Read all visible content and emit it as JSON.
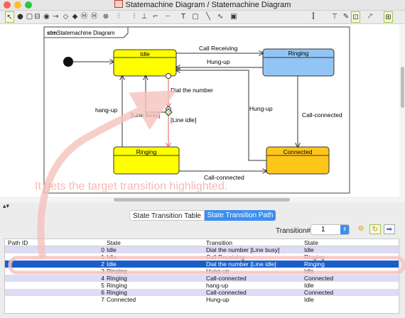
{
  "window": {
    "title": "Statemachine Diagram / Statemachine Diagram"
  },
  "toolbar": {
    "tools": [
      {
        "name": "select-tool-icon",
        "glyph": "↖",
        "selected": true
      },
      {
        "name": "initial-state-tool-icon",
        "glyph": "●"
      },
      {
        "name": "state-tool-icon",
        "glyph": "▢"
      },
      {
        "name": "submachine-state-tool-icon",
        "glyph": "⊟"
      },
      {
        "name": "final-state-tool-icon",
        "glyph": "◉"
      },
      {
        "name": "transition-tool-icon",
        "glyph": "→"
      },
      {
        "name": "choice-tool-icon",
        "glyph": "◇"
      },
      {
        "name": "junction-tool-icon",
        "glyph": "◆"
      },
      {
        "name": "shallow-history-tool-icon",
        "glyph": "Ⓗ"
      },
      {
        "name": "deep-history-tool-icon",
        "glyph": "Ⓗ"
      },
      {
        "name": "entry-point-tool-icon",
        "glyph": "⊗"
      },
      {
        "name": "fork-tool-icon",
        "glyph": "⫶"
      },
      {
        "name": "join-tool-icon",
        "glyph": "⫶"
      },
      {
        "name": "note-tool-icon",
        "glyph": "⊥"
      },
      {
        "name": "anchor-tool-icon",
        "glyph": "⌐"
      },
      {
        "name": "line-tool-icon",
        "glyph": "┈"
      },
      {
        "name": "text-tool-icon",
        "glyph": "T"
      },
      {
        "name": "rectangle-tool-icon",
        "glyph": "▢"
      },
      {
        "name": "line-draw-tool-icon",
        "glyph": "╲"
      },
      {
        "name": "curve-tool-icon",
        "glyph": "∿"
      },
      {
        "name": "image-tool-icon",
        "glyph": "▣"
      },
      {
        "name": "align-vertical-icon",
        "glyph": "⫿"
      },
      {
        "name": "align-horizontal-icon",
        "glyph": "⊤"
      },
      {
        "name": "pin-icon",
        "glyph": "✎"
      },
      {
        "name": "snap-grid-icon",
        "glyph": "⊡",
        "selected": true
      },
      {
        "name": "line-style-icon",
        "glyph": "⤤"
      },
      {
        "name": "layout-icon",
        "glyph": "⊞",
        "selected": true
      }
    ]
  },
  "diagram": {
    "frame_label_kw": "stm",
    "frame_label": "Statemachine Diagram",
    "states": {
      "idle": "Idle",
      "ringing_top": "Ringing",
      "ringing_bottom": "Ringing",
      "connected": "Connected"
    },
    "transitions": {
      "call_receiving": "Call Receiving",
      "hung_up_top": "Hung-up",
      "dial": "Dial the number",
      "hang_up": "hang-up",
      "line_busy": "[Line busy]",
      "line_idle": "[Line idle]",
      "hung_up_right": "Hung-up",
      "call_connected_right": "Call-connected",
      "call_connected_bottom": "Call-connected"
    },
    "colors": {
      "yellow": "#ffff00",
      "blue": "#92c5f5",
      "orange": "#ffc61a",
      "highlight": "#e65b50"
    }
  },
  "annotation": {
    "text": "It gets the target transition highlighted."
  },
  "tabs": [
    {
      "label": "State Transition Table",
      "active": false
    },
    {
      "label": "State Transition Path",
      "active": true
    }
  ],
  "controls": {
    "transition_label": "Transition#",
    "transition_value": "1"
  },
  "table": {
    "columns": [
      "Path ID",
      "State",
      "Transition",
      "State"
    ],
    "rows": [
      {
        "id": "0",
        "from": "Idle",
        "transition": "Dial the number [Line busy]",
        "to": "Idle",
        "style": "lav"
      },
      {
        "id": "1",
        "from": "Idle",
        "transition": "Call Receiving",
        "to": "Ringing",
        "style": "white"
      },
      {
        "id": "2",
        "from": "Idle",
        "transition": "Dial the number [Line idle]",
        "to": "Ringing",
        "style": "sel"
      },
      {
        "id": "3",
        "from": "Ringing",
        "transition": "Hung-up",
        "to": "Idle",
        "style": "white"
      },
      {
        "id": "4",
        "from": "Ringing",
        "transition": "Call-connected",
        "to": "Connected",
        "style": "lav"
      },
      {
        "id": "5",
        "from": "Ringing",
        "transition": "hang-up",
        "to": "Idle",
        "style": "white"
      },
      {
        "id": "6",
        "from": "Ringing",
        "transition": "Call-connected",
        "to": "Connected",
        "style": "lav"
      },
      {
        "id": "7",
        "from": "Connected",
        "transition": "Hung-up",
        "to": "Idle",
        "style": "white"
      }
    ]
  }
}
